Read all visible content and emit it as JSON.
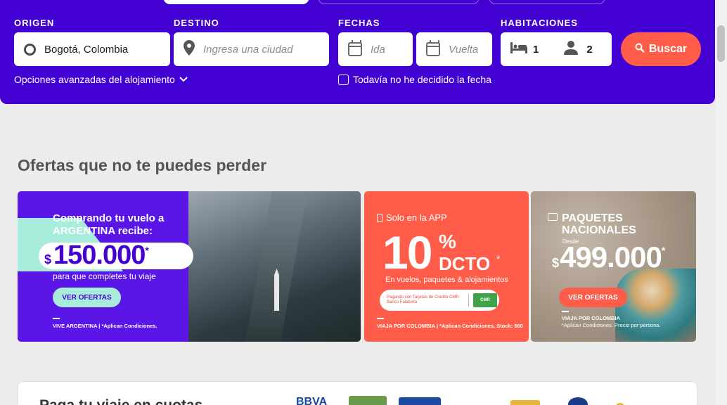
{
  "search": {
    "origin_label": "ORIGEN",
    "origin_value": "Bogotá, Colombia",
    "destination_label": "DESTINO",
    "destination_placeholder": "Ingresa una ciudad",
    "dates_label": "FECHAS",
    "departure_placeholder": "Ida",
    "return_placeholder": "Vuelta",
    "rooms_label": "HABITACIONES",
    "rooms_value": "1",
    "guests_value": "2",
    "search_button": "Buscar",
    "advanced_options": "Opciones avanzadas del alojamiento",
    "undecided_dates": "Todavía no he decidido la fecha",
    "undecided_checked": false
  },
  "offers": {
    "title": "Ofertas que no te puedes perder",
    "argentina": {
      "headline": "Comprando tu vuelo a ARGENTINA recibe:",
      "currency": "$",
      "amount": "150.000",
      "star": "*",
      "subtitle": "para que completes tu viaje",
      "cta": "VER OFERTAS",
      "footer": "VIVE ARGENTINA | *Aplican Condiciones."
    },
    "app_discount": {
      "tag": "Solo en la APP",
      "number": "10",
      "percent": "%",
      "dcto": "DCTO",
      "star": "*",
      "description": "En vuelos, paquetes & alojamientos",
      "card_text": "Pagando con Tarjetas de Crédito CMR Banco Falabella",
      "card_logo": "CMR",
      "footer": "VIAJA POR COLOMBIA | *Aplican Condiciones. Stock: 560"
    },
    "national": {
      "title_line1": "PAQUETES",
      "title_line2": "NACIONALES",
      "from": "Desde",
      "currency": "$",
      "price": "499.000",
      "star": "*",
      "cta": "VER OFERTAS",
      "footer_title": "VIAJA POR COLOMBIA",
      "footer_note": "*Aplican Condiciones. Precio por persona."
    }
  },
  "payments": {
    "title": "Paga tu viaje en cuotas",
    "logo_text": "BBVA"
  },
  "colors": {
    "primary": "#4300d2",
    "accent": "#ff5d4a",
    "mint": "#a8eddc"
  }
}
